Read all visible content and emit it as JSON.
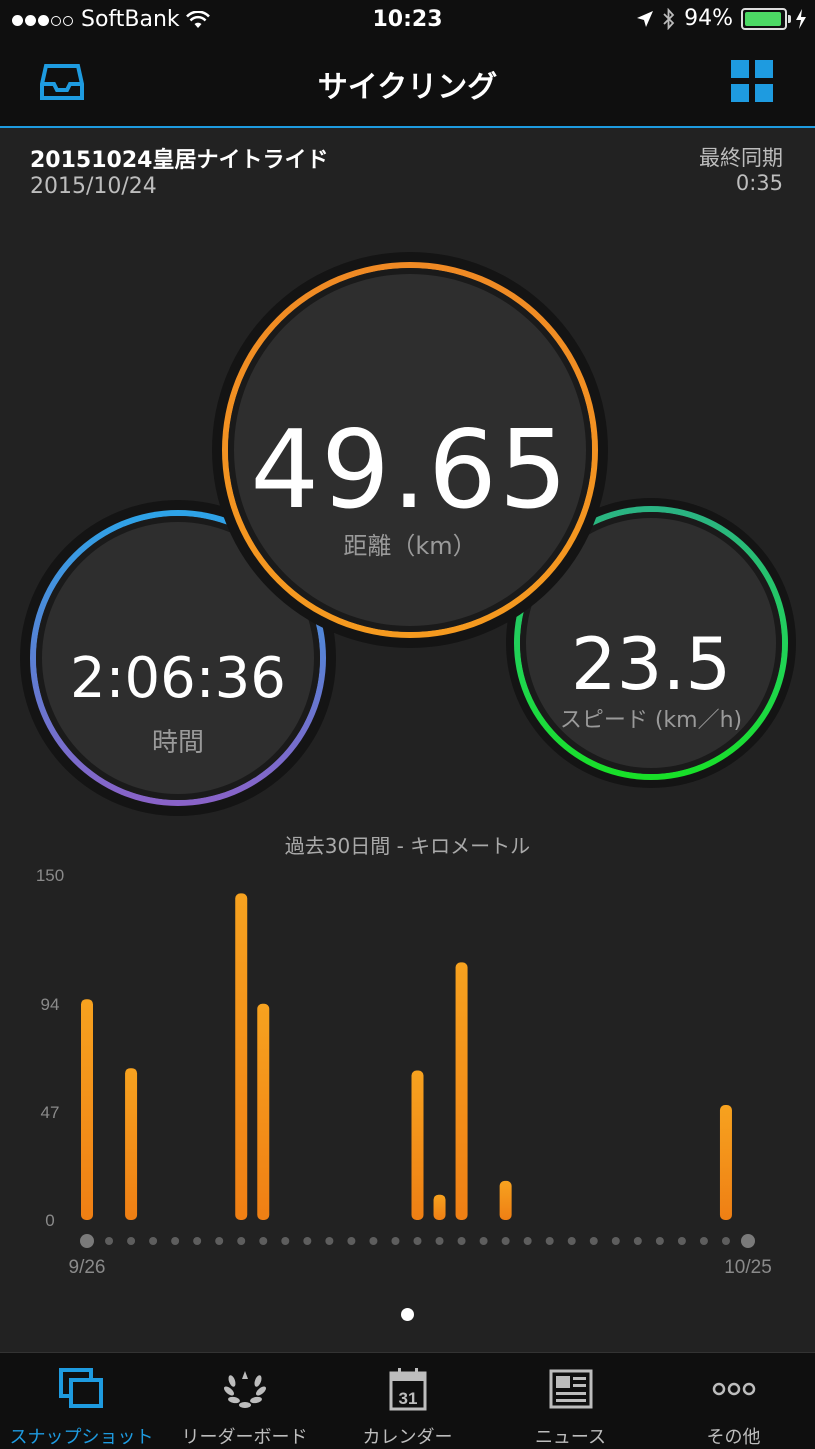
{
  "status": {
    "carrier": "SoftBank",
    "time": "10:23",
    "battery": "94%",
    "battery_level": 0.94
  },
  "nav": {
    "title": "サイクリング"
  },
  "activity": {
    "name": "20151024皇居ナイトライド",
    "date": "2015/10/24",
    "sync_label": "最終同期",
    "sync_time": "0:35"
  },
  "stats": {
    "distance": {
      "value": "49.65",
      "label": "距離（km）"
    },
    "time": {
      "value": "2:06:36",
      "label": "時間"
    },
    "speed": {
      "value": "23.5",
      "label": "スピード (km／h)"
    }
  },
  "chart_data": {
    "type": "bar",
    "title": "過去30日間 - キロメートル",
    "xlabel": "",
    "ylabel": "",
    "ylim": [
      0,
      150
    ],
    "y_ticks": [
      "150",
      "94",
      "47",
      "0"
    ],
    "x_start_label": "9/26",
    "x_end_label": "10/25",
    "days": 30,
    "values": [
      96,
      0,
      66,
      0,
      0,
      0,
      0,
      142,
      94,
      0,
      0,
      0,
      0,
      0,
      0,
      65,
      11,
      112,
      0,
      17,
      0,
      0,
      0,
      0,
      0,
      0,
      0,
      0,
      0,
      50,
      0
    ],
    "color": "#f5961e"
  },
  "tabs": [
    {
      "label": "スナップショット",
      "icon": "snapshot-icon",
      "active": true
    },
    {
      "label": "リーダーボード",
      "icon": "laurel-icon",
      "active": false
    },
    {
      "label": "カレンダー",
      "icon": "calendar-icon",
      "calendar_day": "31",
      "active": false
    },
    {
      "label": "ニュース",
      "icon": "newspaper-icon",
      "active": false
    },
    {
      "label": "その他",
      "icon": "more-icon",
      "active": false
    }
  ],
  "colors": {
    "accent": "#1e9be0",
    "distance_ring": "#f5961e",
    "speed_ring": "#1fd651",
    "time_ring": "#5a80d4"
  }
}
